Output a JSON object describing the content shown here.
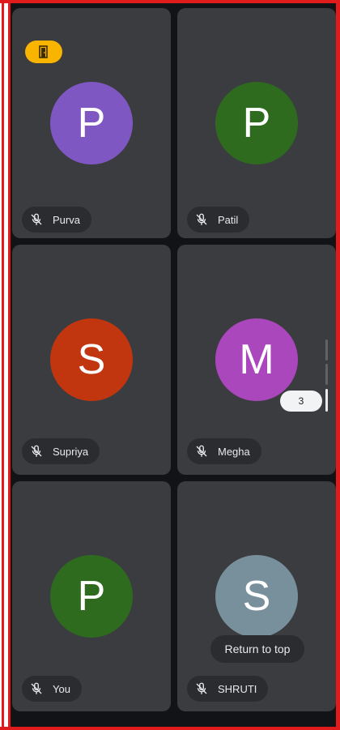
{
  "participants": [
    {
      "name": "Purva",
      "initial": "P",
      "color": "#7e57c2"
    },
    {
      "name": "Patil",
      "initial": "P",
      "color": "#2e6b1f"
    },
    {
      "name": "Supriya",
      "initial": "S",
      "color": "#c1360f"
    },
    {
      "name": "Megha",
      "initial": "M",
      "color": "#ab47bc"
    },
    {
      "name": "You",
      "initial": "P",
      "color": "#2e6b1f"
    },
    {
      "name": "SHRUTI",
      "initial": "S",
      "color": "#78909c"
    }
  ],
  "page_indicator": {
    "label": "3"
  },
  "return_to_top": {
    "label": "Return to top"
  },
  "icons": {
    "muted_mic": "mic-off-icon",
    "badge": "door-exit-icon"
  },
  "colors": {
    "background": "#121316",
    "tile": "#3b3c40",
    "chip": "#2b2c30",
    "badge": "#f9b400",
    "frame": "#e01b1b"
  }
}
